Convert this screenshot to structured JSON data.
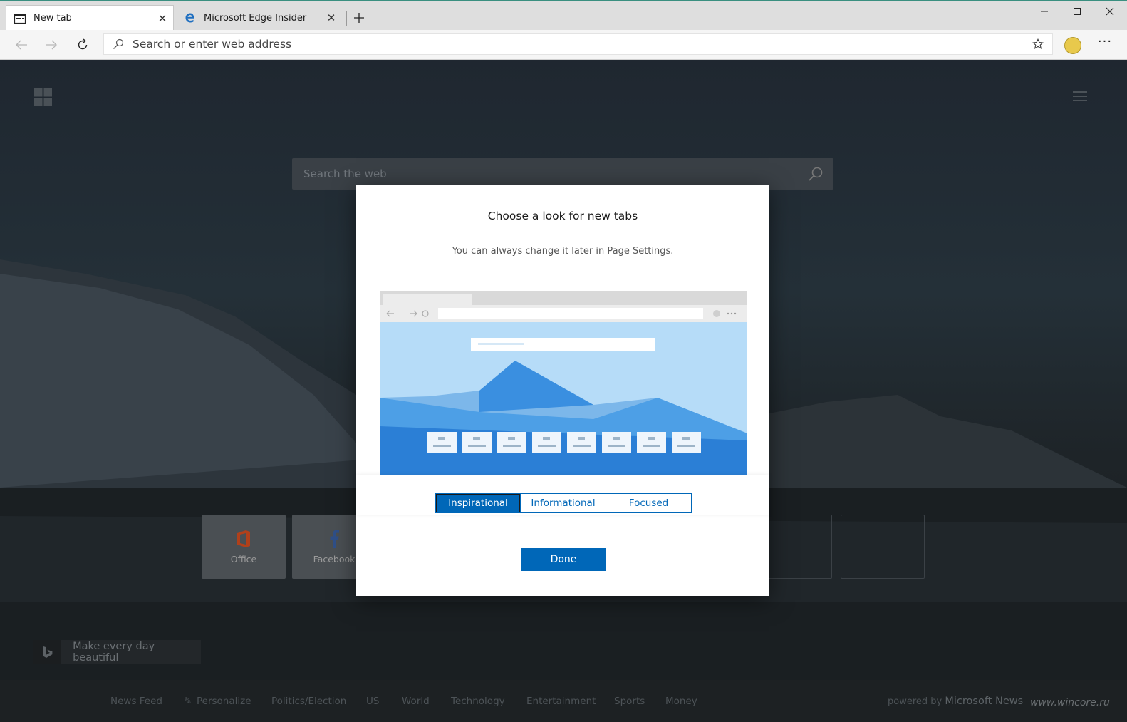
{
  "tabs": [
    {
      "title": "New tab",
      "icon": "new-tab-page-icon",
      "active": true
    },
    {
      "title": "Microsoft Edge Insider",
      "icon": "edge-logo-icon",
      "active": false
    }
  ],
  "address_bar": {
    "placeholder": "Search or enter web address"
  },
  "new_tab_page": {
    "search_placeholder": "Search the web",
    "tiles": [
      {
        "label": "Office",
        "icon": "office-icon",
        "color": "#d04a1d"
      },
      {
        "label": "Facebook",
        "icon": "facebook-icon",
        "color": "#3b5998"
      }
    ],
    "bing_caption": "Make every day beautiful",
    "news_categories": [
      "News Feed",
      "Personalize",
      "Politics/Election",
      "US",
      "World",
      "Technology",
      "Entertainment",
      "Sports",
      "Money"
    ],
    "powered_by_prefix": "powered by",
    "powered_by_brand": "Microsoft News",
    "watermark": "www.wincore.ru"
  },
  "modal": {
    "title": "Choose a look for new tabs",
    "subtitle": "You can always change it later in Page Settings.",
    "options": [
      {
        "label": "Inspirational",
        "selected": true
      },
      {
        "label": "Informational",
        "selected": false
      },
      {
        "label": "Focused",
        "selected": false
      }
    ],
    "done_label": "Done",
    "accent_color": "#0067b8"
  }
}
